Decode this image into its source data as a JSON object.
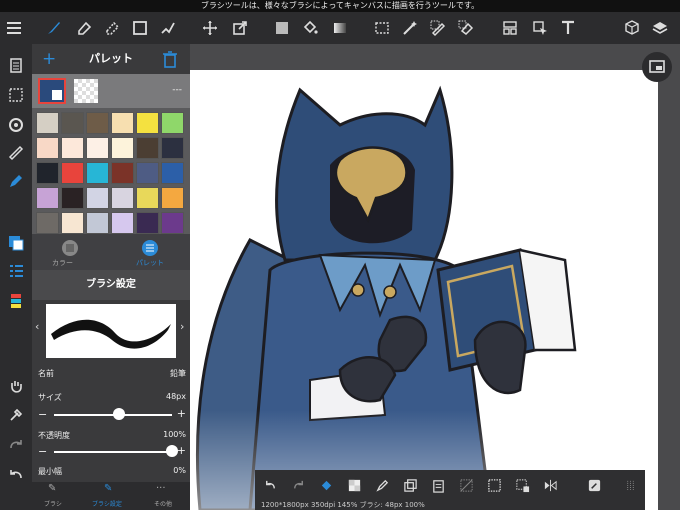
{
  "status_bar": {
    "message": "ブラシツールは、様々なブラシによってキャンバスに描画を行うツールです。"
  },
  "palette": {
    "title": "パレット",
    "selected_color_label": "---",
    "swatches": [
      [
        "#d5cfc4",
        "#5a5650",
        "#6e5c48",
        "#f7dfb0",
        "#f4e140",
        "#8fd76a"
      ],
      [
        "#f8d8c6",
        "#fde8da",
        "#fdf0e6",
        "#fdf3db",
        "#4b3e33",
        "#2c3040"
      ],
      [
        "#20242c",
        "#e8443c",
        "#27b6d6",
        "#7b3328",
        "#4e5c84",
        "#2c5fa8"
      ],
      [
        "#c7a3d6",
        "#2a2224",
        "#d2d4e4",
        "#d8d4e0",
        "#e8d85a",
        "#f4a840"
      ],
      [
        "#6e6a66",
        "#f7e6d2",
        "#c2c8d6",
        "#d6c8ee",
        "#3a2a52",
        "#6c3a8c"
      ]
    ],
    "tabs": [
      {
        "label": "カラー"
      },
      {
        "label": "パレット"
      }
    ]
  },
  "brush": {
    "title": "ブラシ設定",
    "name_label": "名前",
    "name_value": "鉛筆",
    "size_label": "サイズ",
    "size_value": "48px",
    "size_pct": 0.55,
    "opacity_label": "不透明度",
    "opacity_value": "100%",
    "opacity_pct": 1.0,
    "minwidth_label": "最小幅",
    "minwidth_value": "0%",
    "bottom_tabs": [
      {
        "label": "ブラシ"
      },
      {
        "label": "ブラシ設定"
      },
      {
        "label": "その他"
      }
    ]
  },
  "canvas_info": "1200*1800px 350dpi 145% ブラシ: 48px 100%",
  "colors": {
    "accent": "#2b8bd8",
    "selected_swatch": "#2a4a7c",
    "navy": "#2f4d78"
  }
}
